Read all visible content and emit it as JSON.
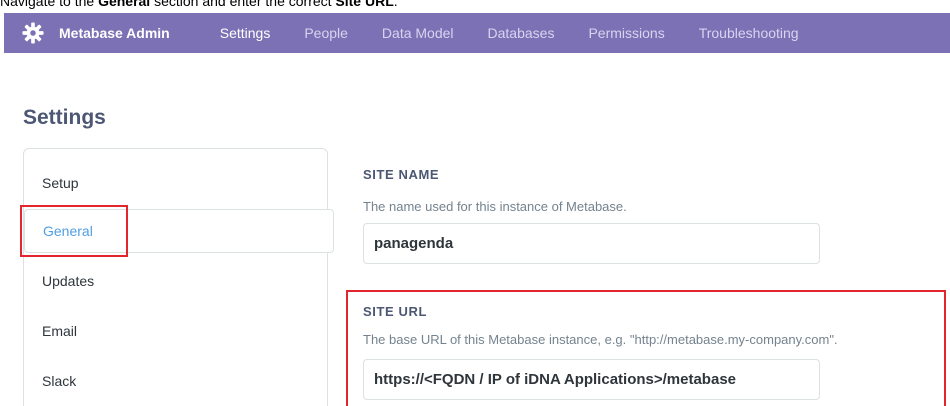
{
  "caption": {
    "prefix": "Navigate to the ",
    "section": "General",
    "middle": " section and enter the correct ",
    "field": "Site URL",
    "suffix": "."
  },
  "navbar": {
    "brand": "Metabase Admin",
    "items": [
      {
        "label": "Settings",
        "active": true
      },
      {
        "label": "People"
      },
      {
        "label": "Data Model"
      },
      {
        "label": "Databases"
      },
      {
        "label": "Permissions"
      },
      {
        "label": "Troubleshooting"
      }
    ]
  },
  "page_title": "Settings",
  "sidebar": {
    "items": [
      {
        "label": "Setup"
      },
      {
        "label": "General",
        "selected": true
      },
      {
        "label": "Updates"
      },
      {
        "label": "Email"
      },
      {
        "label": "Slack"
      }
    ]
  },
  "settings": {
    "site_name": {
      "label": "SITE NAME",
      "description": "The name used for this instance of Metabase.",
      "value": "panagenda"
    },
    "site_url": {
      "label": "SITE URL",
      "description": "The base URL of this Metabase instance, e.g. \"http://metabase.my-company.com\".",
      "value": "https://<FQDN / IP of iDNA Applications>/metabase"
    }
  },
  "colors": {
    "navbar": "#7b71b4",
    "accent": "#509ee3",
    "highlight": "#e3262e"
  },
  "icons": {
    "brand": "gear-icon"
  }
}
